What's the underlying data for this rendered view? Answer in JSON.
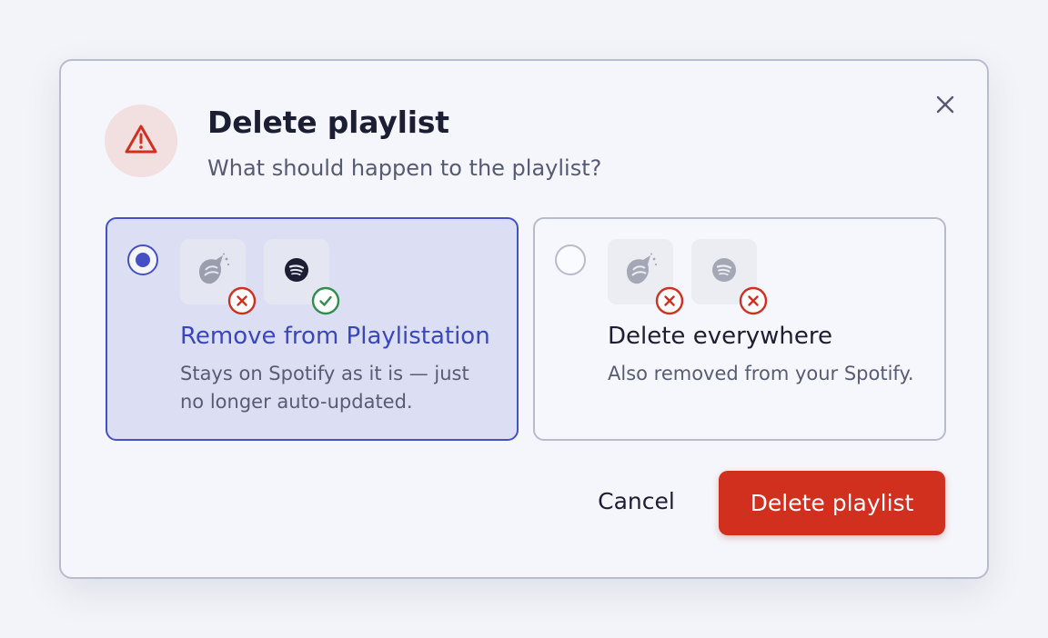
{
  "dialog": {
    "title": "Delete playlist",
    "subtitle": "What should happen to the playlist?",
    "icons": {
      "warning": "warning-triangle-icon",
      "close": "close-icon"
    }
  },
  "options": [
    {
      "id": "remove-from-playlistation",
      "selected": true,
      "title": "Remove from Playlistation",
      "description": "Stays on Spotify as it is — just no longer auto-updated.",
      "apps": [
        {
          "icon": "playlistation-logo-icon",
          "status": "removed"
        },
        {
          "icon": "spotify-logo-icon",
          "status": "kept"
        }
      ]
    },
    {
      "id": "delete-everywhere",
      "selected": false,
      "title": "Delete everywhere",
      "description": "Also removed from your Spotify.",
      "apps": [
        {
          "icon": "playlistation-logo-icon",
          "status": "removed"
        },
        {
          "icon": "spotify-logo-icon",
          "status": "removed"
        }
      ]
    }
  ],
  "actions": {
    "cancel_label": "Cancel",
    "delete_label": "Delete playlist"
  },
  "colors": {
    "accent": "#4450c4",
    "danger": "#d2301f",
    "success": "#2f8f4e"
  }
}
